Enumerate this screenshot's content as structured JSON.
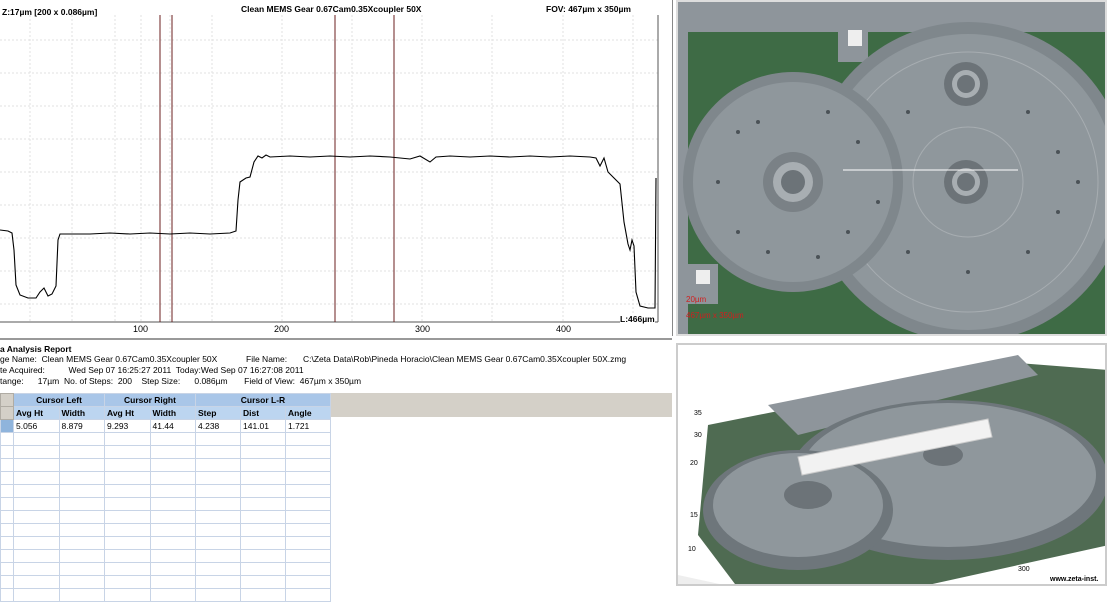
{
  "profile": {
    "z_info": "Z:17µm [200 x 0.086µm]",
    "title": "Clean MEMS Gear 0.67Cam0.35Xcoupler 50X",
    "fov": "FOV: 467µm x 350µm",
    "length_label": "L:466µm",
    "x_ticks": [
      "100",
      "200",
      "300",
      "400"
    ]
  },
  "report": {
    "heading": "a Analysis Report",
    "line1_a": "ge Name:  Clean MEMS Gear 0.67Cam0.35Xcoupler 50X",
    "line1_b": "File Name:",
    "line1_c": "C:\\Zeta Data\\Rob\\Pineda Horacio\\Clean MEMS Gear 0.67Cam0.35Xcoupler 50X.zmg",
    "line2": "te Acquired:          Wed Sep 07 16:25:27 2011  Today:Wed Sep 07 16:27:08 2011",
    "line3": "tange:      17µm  No. of Steps:  200    Step Size:      0.086µm       Field of View:  467µm x 350µm",
    "groups": [
      "Cursor Left",
      "Cursor Right",
      "Cursor L-R"
    ],
    "columns": [
      "Avg Ht",
      "Width",
      "Avg Ht",
      "Width",
      "Step",
      "Dist",
      "Angle"
    ],
    "row": [
      "5.056",
      "8.879",
      "9.293",
      "41.44",
      "4.238",
      "141.01",
      "1.721"
    ]
  },
  "image2d": {
    "scale_text_1": "20µm",
    "scale_text_2": "467µm x 350µm"
  },
  "image3d": {
    "axis_labels": [
      "35",
      "30",
      "20",
      "15",
      "10"
    ],
    "x_axis_label": "300",
    "watermark": "www.zeta-inst."
  },
  "colors": {
    "profile_line": "#000000",
    "cursor_line": "#6b1f1f",
    "table_header": "#a9c6e8",
    "gear_surface": "#8d949a",
    "background_green": "#3e6b45"
  }
}
